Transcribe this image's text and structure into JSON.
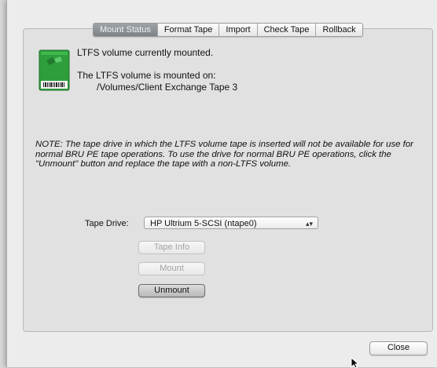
{
  "tabs": [
    {
      "label": "Mount Status",
      "selected": true
    },
    {
      "label": "Format Tape",
      "selected": false
    },
    {
      "label": "Import",
      "selected": false
    },
    {
      "label": "Check Tape",
      "selected": false
    },
    {
      "label": "Rollback",
      "selected": false
    }
  ],
  "status": {
    "title": "LTFS volume currently mounted.",
    "mounted_on_label": "The LTFS volume is mounted on:",
    "mount_path": "/Volumes/Client Exchange Tape 3"
  },
  "note": "NOTE: The tape drive in which the LTFS volume tape is inserted will not be available for use for normal BRU PE tape operations.  To use the drive for normal BRU PE operations, click the \"Unmount\" button and replace the tape with a non-LTFS volume.",
  "tape_drive": {
    "label": "Tape Drive:",
    "selected": "HP Ultrium 5-SCSI (ntape0)"
  },
  "buttons": {
    "tape_info": "Tape Info",
    "mount": "Mount",
    "unmount": "Unmount",
    "close": "Close"
  },
  "icons": {
    "tape": "tape-cartridge-icon",
    "select_arrows": "updown-arrows-icon",
    "cursor": "mouse-pointer-icon"
  },
  "colors": {
    "tape_green": "#2e9e3c",
    "selected_tab": "#8a8f94"
  }
}
